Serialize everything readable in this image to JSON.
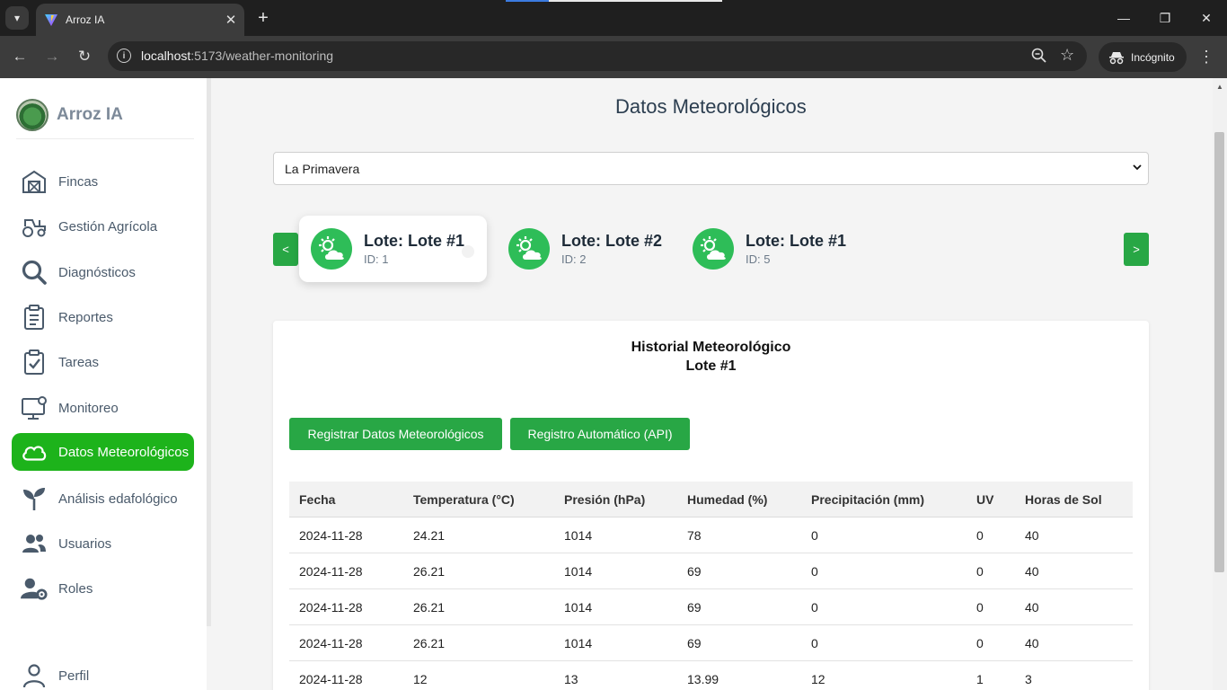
{
  "browser": {
    "tab_title": "Arroz IA",
    "url_host": "localhost",
    "url_path": ":5173/weather-monitoring",
    "incognito_label": "Incógnito"
  },
  "sidebar": {
    "brand": "Arroz IA",
    "items": [
      {
        "label": "Fincas",
        "icon": "barn-icon"
      },
      {
        "label": "Gestión Agrícola",
        "icon": "tractor-icon"
      },
      {
        "label": "Diagnósticos",
        "icon": "search-icon"
      },
      {
        "label": "Reportes",
        "icon": "clipboard-icon"
      },
      {
        "label": "Tareas",
        "icon": "clipboard-check-icon"
      },
      {
        "label": "Monitoreo",
        "icon": "monitor-icon"
      },
      {
        "label": "Datos Meteorológicos",
        "icon": "cloud-icon",
        "active": true
      },
      {
        "label": "Análisis edafológico",
        "icon": "sprout-icon"
      },
      {
        "label": "Usuarios",
        "icon": "users-icon"
      },
      {
        "label": "Roles",
        "icon": "user-gear-icon"
      }
    ],
    "profile_label": "Perfil"
  },
  "main": {
    "title": "Datos Meteorológicos",
    "finca_select": "La Primavera",
    "carousel_prev": "<",
    "carousel_next": ">",
    "lotes": [
      {
        "name": "Lote: Lote #1",
        "id": "ID: 1",
        "selected": true
      },
      {
        "name": "Lote: Lote #2",
        "id": "ID: 2",
        "selected": false
      },
      {
        "name": "Lote: Lote #1",
        "id": "ID: 5",
        "selected": false
      }
    ],
    "history_title": "Historial Meteorológico",
    "history_subtitle": "Lote #1",
    "btn_register": "Registrar Datos Meteorológicos",
    "btn_auto": "Registro Automático (API)",
    "table": {
      "headers": [
        "Fecha",
        "Temperatura (°C)",
        "Presión (hPa)",
        "Humedad (%)",
        "Precipitación (mm)",
        "UV",
        "Horas de Sol"
      ],
      "rows": [
        [
          "2024-11-28",
          "24.21",
          "1014",
          "78",
          "0",
          "0",
          "40"
        ],
        [
          "2024-11-28",
          "26.21",
          "1014",
          "69",
          "0",
          "0",
          "40"
        ],
        [
          "2024-11-28",
          "26.21",
          "1014",
          "69",
          "0",
          "0",
          "40"
        ],
        [
          "2024-11-28",
          "26.21",
          "1014",
          "69",
          "0",
          "0",
          "40"
        ],
        [
          "2024-11-28",
          "12",
          "13",
          "13.99",
          "12",
          "1",
          "3"
        ]
      ]
    }
  },
  "colors": {
    "accent": "#28a745",
    "active_nav": "#1db31b",
    "weather_icon_bg": "#2ebd58"
  }
}
